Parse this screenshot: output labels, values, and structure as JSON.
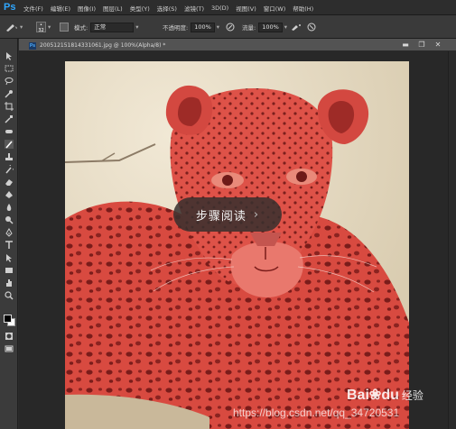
{
  "app": {
    "logo": "Ps"
  },
  "menu": [
    "文件(F)",
    "编辑(E)",
    "图像(I)",
    "图层(L)",
    "类型(Y)",
    "选择(S)",
    "滤镜(T)",
    "3D(D)",
    "视图(V)",
    "窗口(W)",
    "帮助(H)"
  ],
  "options": {
    "brush_size": "32",
    "mode_label": "模式:",
    "mode_value": "正常",
    "opacity_label": "不透明度:",
    "opacity_value": "100%",
    "flow_label": "流量:",
    "flow_value": "100%"
  },
  "document": {
    "tab_title": "200512151814331061.jpg @ 100%(Alpha/8) *",
    "minimize": "▬",
    "restore": "❐",
    "close": "✕"
  },
  "tools": [
    "move-icon",
    "marquee-icon",
    "lasso-icon",
    "quick-select-icon",
    "crop-icon",
    "eyedropper-icon",
    "healing-icon",
    "brush-icon",
    "clone-stamp-icon",
    "history-brush-icon",
    "eraser-icon",
    "gradient-icon",
    "blur-icon",
    "dodge-icon",
    "pen-icon",
    "type-icon",
    "path-select-icon",
    "shape-icon",
    "hand-icon",
    "zoom-icon"
  ],
  "colors": {
    "foreground": "#000000",
    "background": "#ffffff",
    "quick_mask_overlay": "#e0463f"
  },
  "overlay": {
    "step_reading": "步骤阅读",
    "chevron": "›"
  },
  "watermarks": {
    "baidu": "Bai",
    "baidu_paw": "❀",
    "baidu_du": "du",
    "jingyan": "经验",
    "blog": "https://blog.csdn.net/qq_34720531"
  }
}
